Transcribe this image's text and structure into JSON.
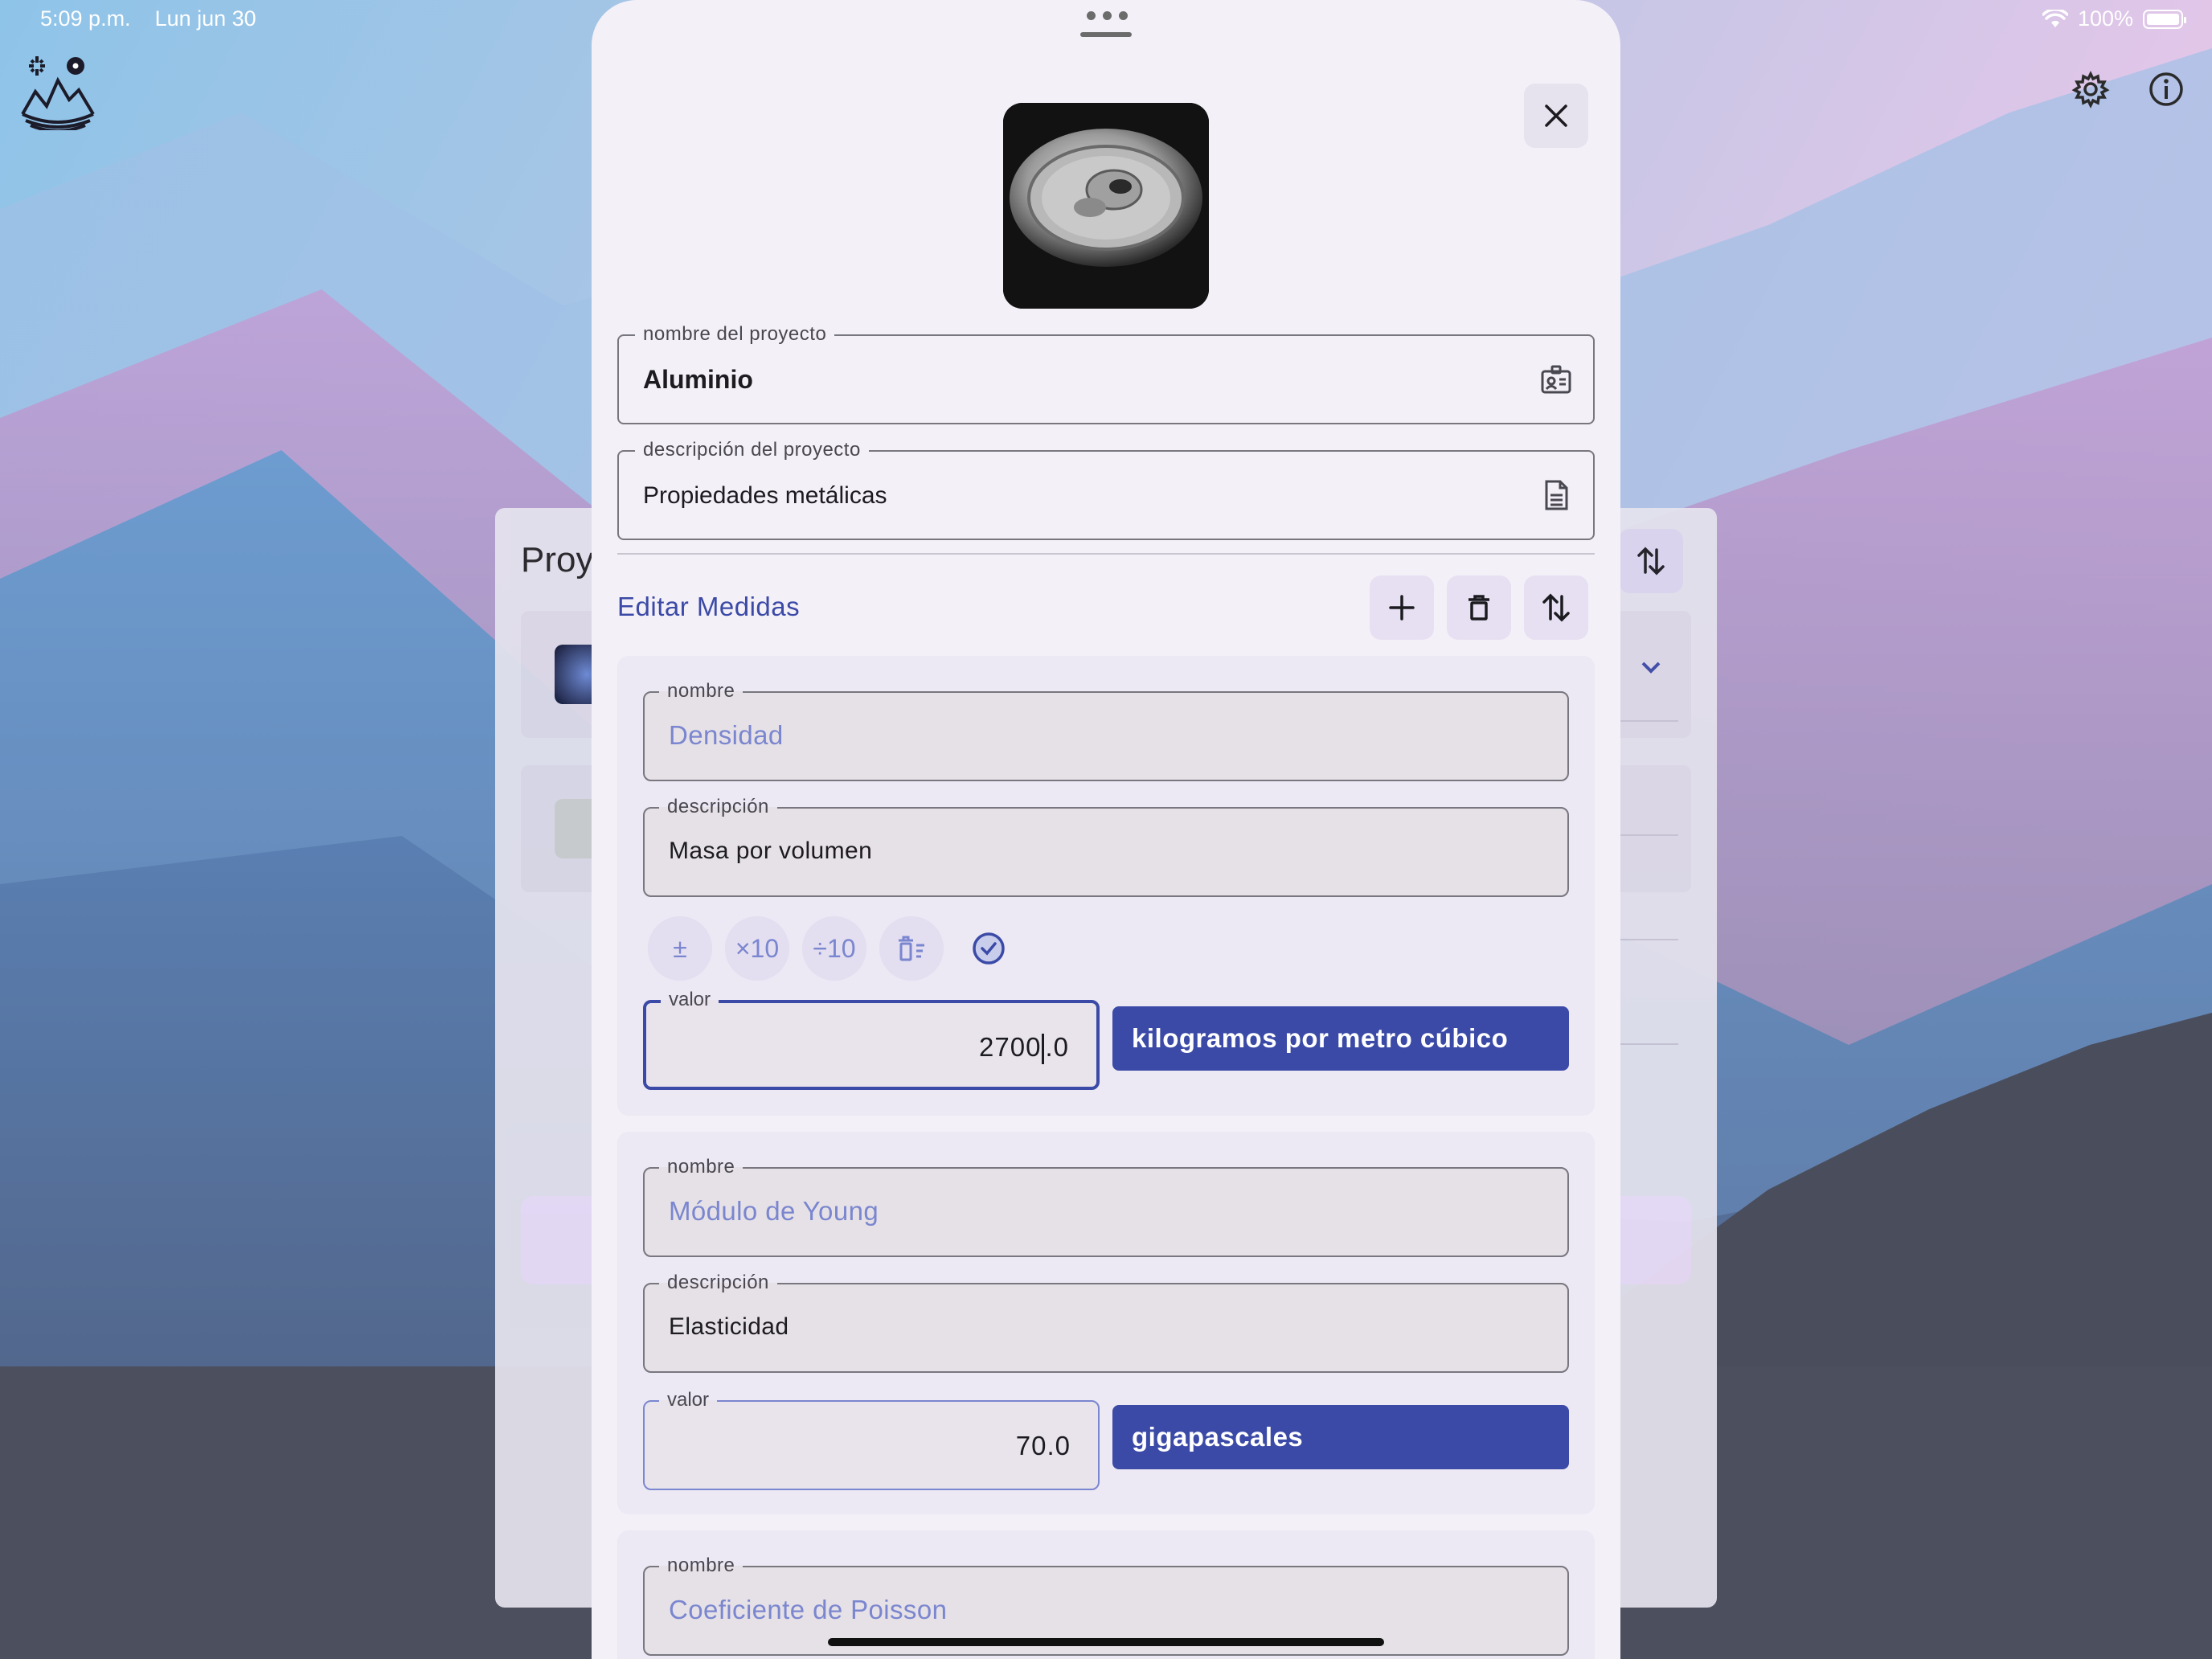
{
  "status_bar": {
    "time": "5:09 p.m.",
    "date": "Lun jun 30",
    "battery": "100%"
  },
  "behind": {
    "title": "Proy"
  },
  "sheet": {
    "project_name_label": "nombre del proyecto",
    "project_name_value": "Aluminio",
    "project_desc_label": "descripción del proyecto",
    "project_desc_value": "Propiedades metálicas",
    "section_title": "Editar Medidas",
    "tools": [
      "add-icon",
      "trash-icon",
      "sort-icon"
    ]
  },
  "measures": [
    {
      "name_label": "nombre",
      "name": "Densidad",
      "desc_label": "descripción",
      "desc": "Masa por volumen",
      "value_label": "valor",
      "value_before_caret": "2700",
      "value_after_caret": ".0",
      "unit": "kilogramos por metro cúbico",
      "ops": [
        "±",
        "×10",
        "÷10"
      ]
    },
    {
      "name_label": "nombre",
      "name": "Módulo de Young",
      "desc_label": "descripción",
      "desc": "Elasticidad",
      "value_label": "valor",
      "value": "70.0",
      "unit": "gigapascales"
    },
    {
      "name_label": "nombre",
      "name": "Coeficiente de Poisson"
    }
  ],
  "colors": {
    "accent": "#3b4aa6",
    "accent_light": "#7a86cf",
    "sheet_bg": "#f4f0f8",
    "card_bg": "#ece8f4"
  }
}
